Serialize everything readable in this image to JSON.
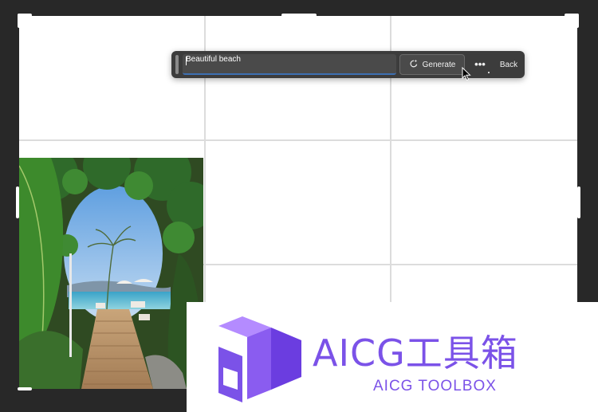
{
  "canvas": {
    "background": "#ffffff",
    "grid_color": "#dcdcdc"
  },
  "taskbar": {
    "prompt_value": "Beautiful beach",
    "generate_label": "Generate",
    "generate_icon": "sparkle-refresh-icon",
    "more_label": "•••",
    "back_label": "Back"
  },
  "watermark": {
    "title": "AICG工具箱",
    "subtitle": "AICG TOOLBOX",
    "color": "#7b52e8",
    "logo_icon": "aicg-cube-logo"
  },
  "colors": {
    "app_background": "#282828",
    "taskbar_background": "#3c3c3c",
    "prompt_underline": "#3d6fb2"
  }
}
